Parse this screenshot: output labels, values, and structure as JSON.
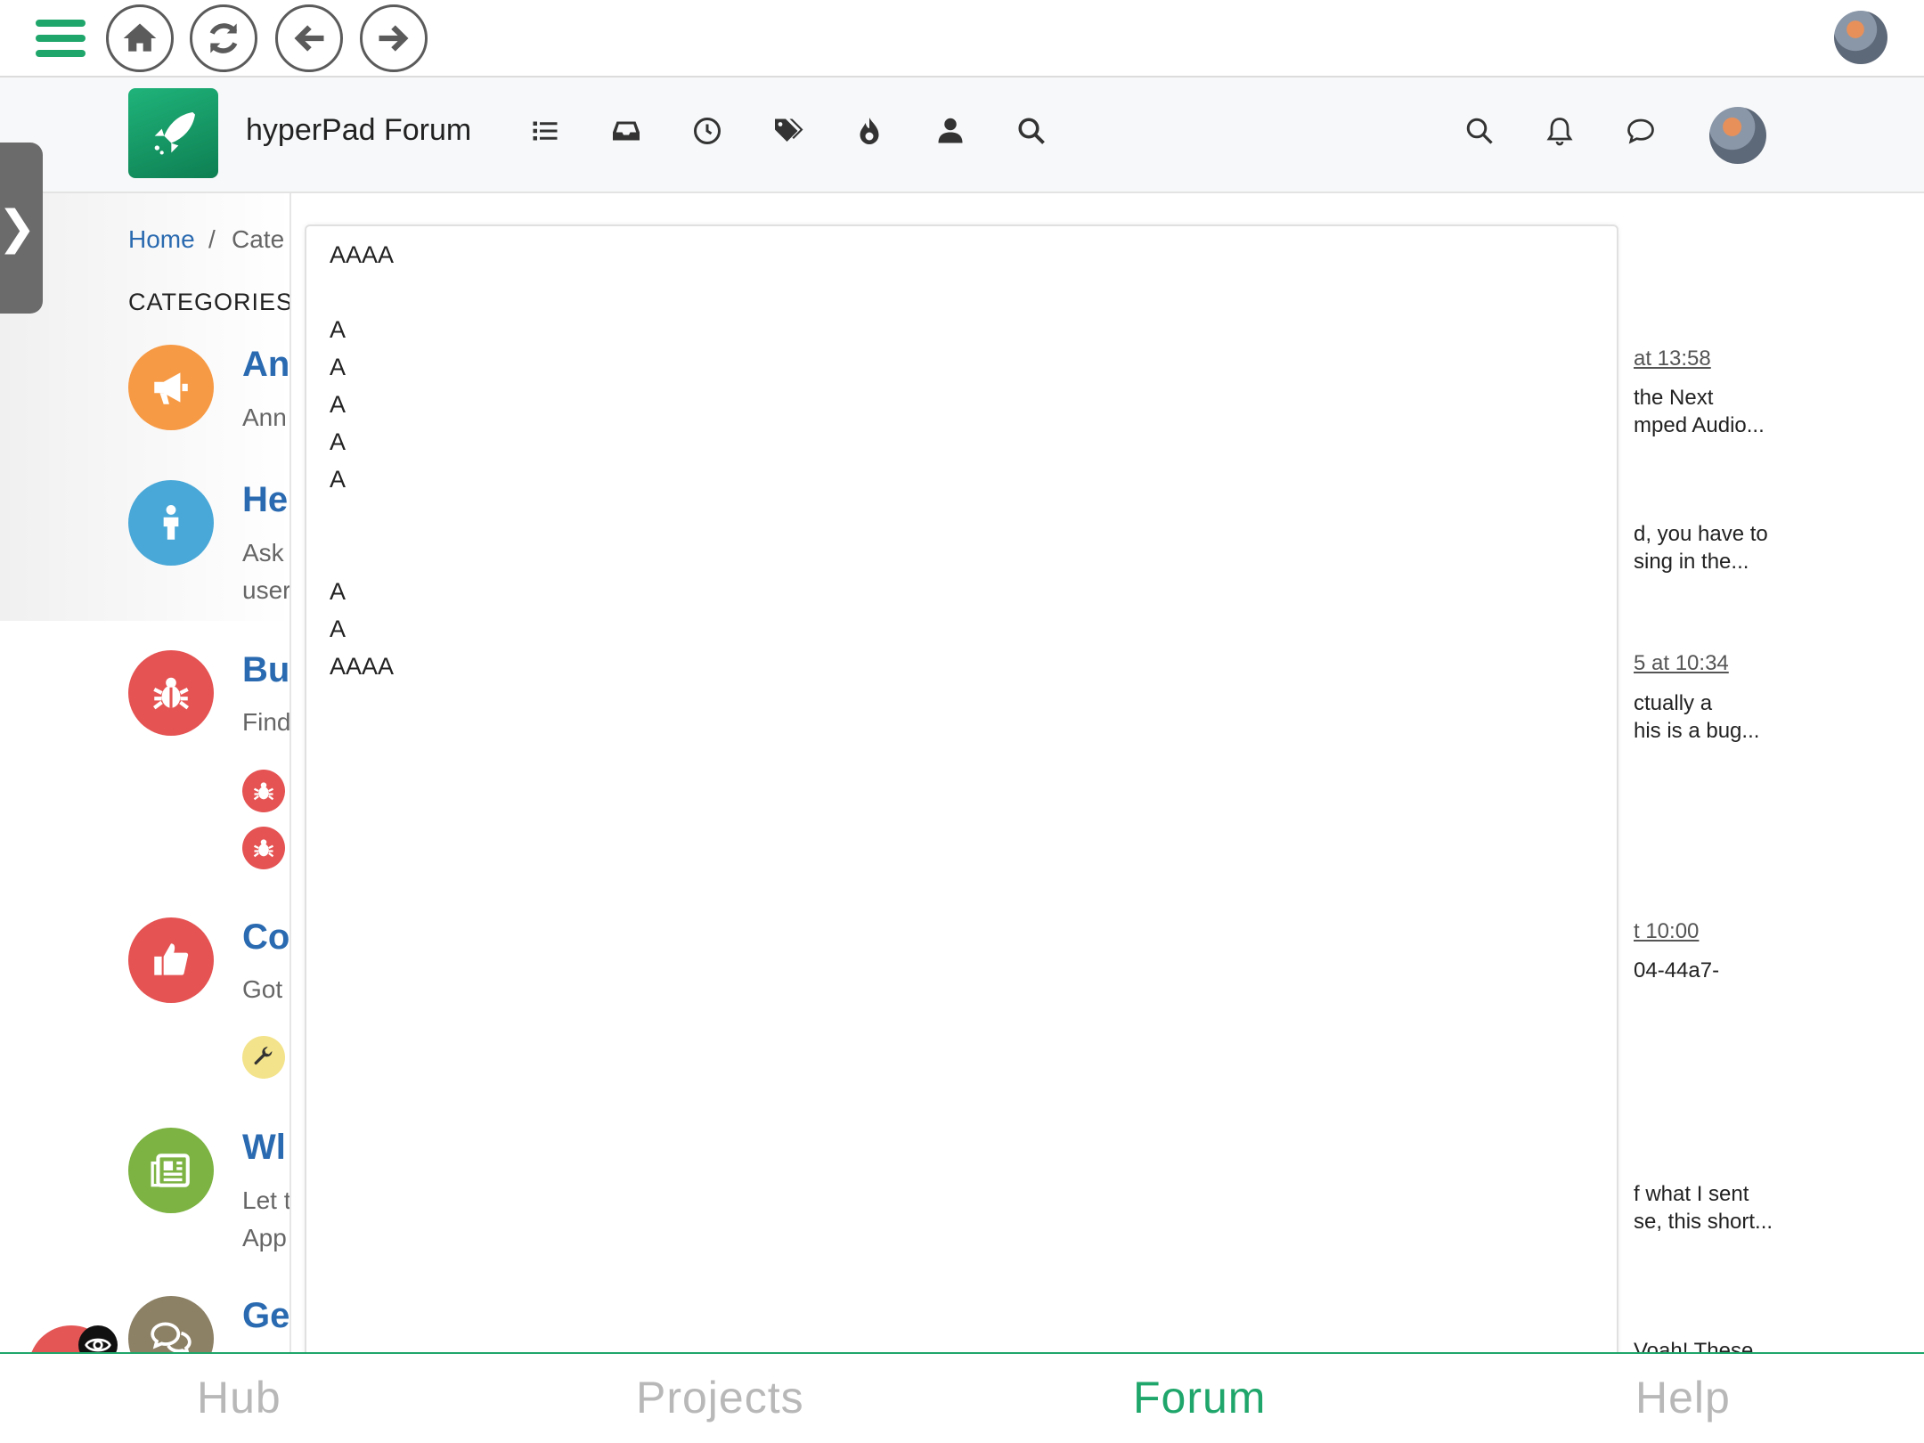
{
  "app_bar": {
    "menu_icon": "hamburger-icon",
    "nav_buttons": [
      "home-icon",
      "refresh-icon",
      "back-arrow-icon",
      "forward-arrow-icon"
    ],
    "avatar": "user-avatar"
  },
  "forum_header": {
    "title": "hyperPad Forum",
    "nav_icons": [
      "list-icon",
      "inbox-icon",
      "clock-icon",
      "tags-icon",
      "fire-icon",
      "user-icon",
      "search-icon"
    ],
    "right_icons": [
      "search-icon",
      "bell-icon",
      "chat-icon"
    ]
  },
  "breadcrumb": {
    "home": "Home",
    "separator": "/",
    "current": "Cate"
  },
  "categories": {
    "heading": "CATEGORIES",
    "items": [
      {
        "title": "An",
        "desc": [
          "Ann"
        ],
        "color": "#f79a45",
        "icon": "megaphone-icon"
      },
      {
        "title": "He",
        "desc": [
          "Ask",
          "user"
        ],
        "color": "#4aa8d8",
        "icon": "person-icon"
      },
      {
        "title": "Bu",
        "desc": [
          "Find"
        ],
        "color": "#e55353",
        "icon": "bug-icon"
      },
      {
        "title": "Co",
        "desc": [
          "Got"
        ],
        "color": "#e55353",
        "icon": "thumbs-up-icon"
      },
      {
        "title": "Wl",
        "desc": [
          "Let t",
          "App"
        ],
        "color": "#7cb342",
        "icon": "newspaper-icon"
      },
      {
        "title": "Ge",
        "desc": [],
        "color": "#8c8065",
        "icon": "comments-icon"
      }
    ],
    "sub_icons": [
      {
        "icon": "bug-icon",
        "color": "#e55353"
      },
      {
        "icon": "bug-icon",
        "color": "#e55353"
      },
      {
        "icon": "wrench-icon",
        "color": "#f3e38a"
      }
    ]
  },
  "recent_posts": [
    {
      "time": "at 13:58",
      "snippet": [
        "the Next",
        "mped Audio..."
      ]
    },
    {
      "time": "",
      "snippet": [
        "d, you have to",
        "sing in the..."
      ]
    },
    {
      "time": "5 at 10:34",
      "snippet": [
        "ctually a",
        "his is a bug..."
      ]
    },
    {
      "time": "t 10:00",
      "snippet": [
        "04-44a7-"
      ]
    },
    {
      "time": "",
      "snippet": [
        "f what I sent",
        "se, this short..."
      ]
    },
    {
      "time": "",
      "snippet": [
        "Voah! These"
      ]
    }
  ],
  "panel": {
    "lines": [
      "AAAA",
      "",
      "A",
      "A",
      "A",
      "A",
      "A",
      "",
      "",
      "A",
      "A",
      "AAAA"
    ]
  },
  "tabbar": {
    "tabs": [
      "Hub",
      "Projects",
      "Forum",
      "Help"
    ],
    "active": "Forum"
  },
  "colors": {
    "accent": "#1fa66b",
    "link": "#2a6ab0"
  }
}
